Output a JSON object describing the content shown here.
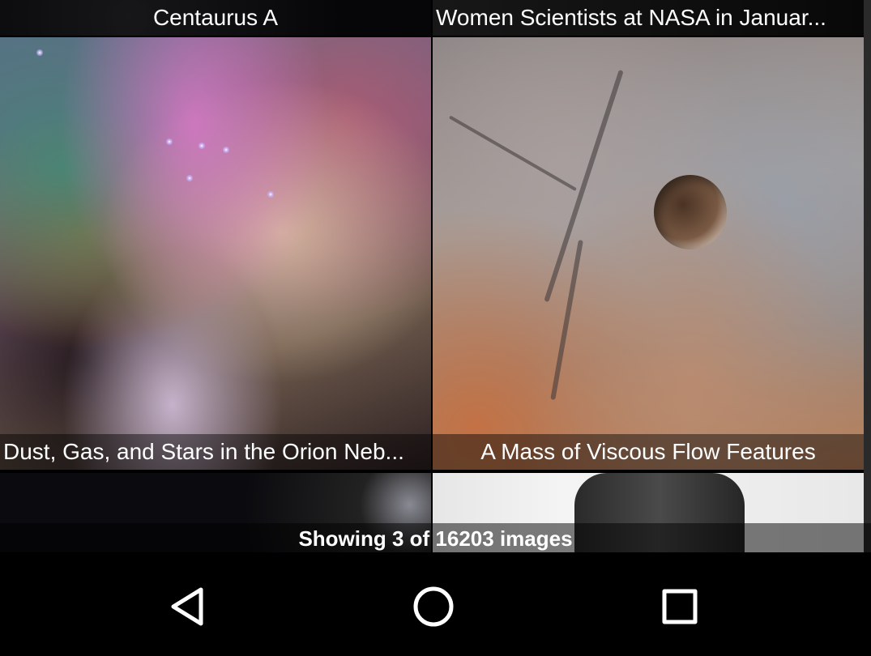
{
  "gallery": {
    "tiles": [
      {
        "title": "Centaurus A"
      },
      {
        "title": "Women Scientists at NASA in Januar..."
      },
      {
        "title": "Dust, Gas, and Stars in the Orion Neb..."
      },
      {
        "title": "A Mass of Viscous Flow Features"
      },
      {
        "title": ""
      },
      {
        "title": ""
      }
    ]
  },
  "status": {
    "text": "Showing 3 of 16203 images"
  },
  "nav": {
    "back_icon": "back-triangle-icon",
    "home_icon": "home-circle-icon",
    "recents_icon": "recents-square-icon"
  },
  "colors": {
    "caption_overlay": "#000000",
    "nav_bar": "#000000",
    "icon": "#ffffff"
  }
}
